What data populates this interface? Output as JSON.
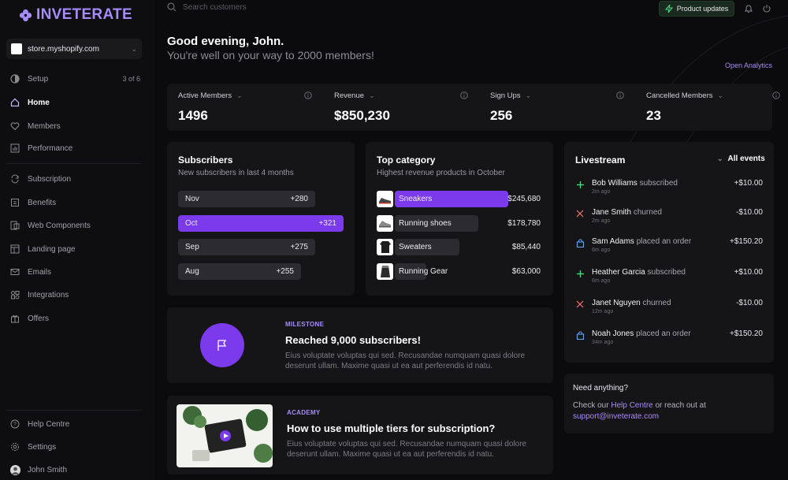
{
  "brand": {
    "name": "INVETERATE",
    "accent": "#7c3aed",
    "accent_light": "#a78bfa"
  },
  "store": {
    "name": "store.myshopify.com"
  },
  "nav": [
    {
      "label": "Setup",
      "icon": "progress-circle-icon",
      "count": "3 of 6"
    },
    {
      "label": "Home",
      "icon": "home-icon",
      "active": true
    },
    {
      "label": "Members",
      "icon": "heart-icon"
    },
    {
      "label": "Performance",
      "icon": "chart-icon"
    },
    {
      "label": "Subscription",
      "icon": "refresh-icon"
    },
    {
      "label": "Benefits",
      "icon": "gift-tag-icon"
    },
    {
      "label": "Web Components",
      "icon": "components-icon"
    },
    {
      "label": "Landing page",
      "icon": "layout-icon"
    },
    {
      "label": "Emails",
      "icon": "mail-icon"
    },
    {
      "label": "Integrations",
      "icon": "grid-icon"
    },
    {
      "label": "Offers",
      "icon": "gift-icon"
    }
  ],
  "nav_bottom": [
    {
      "label": "Help Centre",
      "icon": "help-icon"
    },
    {
      "label": "Settings",
      "icon": "gear-icon"
    },
    {
      "label": "John Smith",
      "icon": "avatar"
    }
  ],
  "topbar": {
    "search_placeholder": "Search customers",
    "product_updates": "Product updates"
  },
  "greeting": {
    "title": "Good evening, John.",
    "subtitle": "You're well on your way to 2000 members!",
    "open_analytics": "Open Analytics"
  },
  "metrics": [
    {
      "label": "Active Members",
      "value": "1496"
    },
    {
      "label": "Revenue",
      "value": "$850,230"
    },
    {
      "label": "Sign Ups",
      "value": "256"
    },
    {
      "label": "Cancelled Members",
      "value": "23"
    }
  ],
  "subscribers": {
    "title": "Subscribers",
    "subtitle": "New subscribers in last 4 months",
    "rows": [
      {
        "month": "Nov",
        "value": "+280"
      },
      {
        "month": "Oct",
        "value": "+321",
        "highlight": true
      },
      {
        "month": "Sep",
        "value": "+275"
      },
      {
        "month": "Aug",
        "value": "+255"
      }
    ]
  },
  "top_category": {
    "title": "Top category",
    "subtitle": "Highest revenue products in October",
    "rows": [
      {
        "name": "Sneakers",
        "amount": "$245,680",
        "highlight": true
      },
      {
        "name": "Running shoes",
        "amount": "$178,780"
      },
      {
        "name": "Sweaters",
        "amount": "$85,440"
      },
      {
        "name": "Running Gear",
        "amount": "$63,000"
      }
    ]
  },
  "livestream": {
    "title": "Livestream",
    "filter": "All events",
    "events": [
      {
        "type": "subscribed",
        "name": "Bob Williams",
        "action": "subscribed",
        "time": "2m ago",
        "amount": "+$10.00"
      },
      {
        "type": "churned",
        "name": "Jane Smith",
        "action": "churned",
        "time": "2m ago",
        "amount": "-$10.00"
      },
      {
        "type": "order",
        "name": "Sam Adams",
        "action": "placed an order",
        "time": "6m ago",
        "amount": "+$150.20"
      },
      {
        "type": "subscribed",
        "name": "Heather Garcia",
        "action": "subscribed",
        "time": "6m ago",
        "amount": "+$10.00"
      },
      {
        "type": "churned",
        "name": "Janet Nguyen",
        "action": "churned",
        "time": "12m ago",
        "amount": "-$10.00"
      },
      {
        "type": "order",
        "name": "Noah Jones",
        "action": "placed an order",
        "time": "34m ago",
        "amount": "+$150.20"
      }
    ]
  },
  "milestone": {
    "tag": "MILESTONE",
    "title": "Reached 9,000 subscribers!",
    "body": "Eius voluptate voluptas qui sed. Recusandae numquam quasi dolore deserunt ullam. Maxime quasi ut ea aut perferendis id natu."
  },
  "academy": {
    "tag": "ACADEMY",
    "title": "How to use multiple tiers for subscription?",
    "body": "Eius voluptate voluptas qui sed. Recusandae numquam quasi dolore deserunt ullam. Maxime quasi ut ea aut perferendis id natu."
  },
  "help": {
    "title": "Need anything?",
    "line1_pre": "Check our ",
    "link": "Help Centre",
    "line1_post": " or reach out at",
    "email": "support@inveterate.com"
  }
}
